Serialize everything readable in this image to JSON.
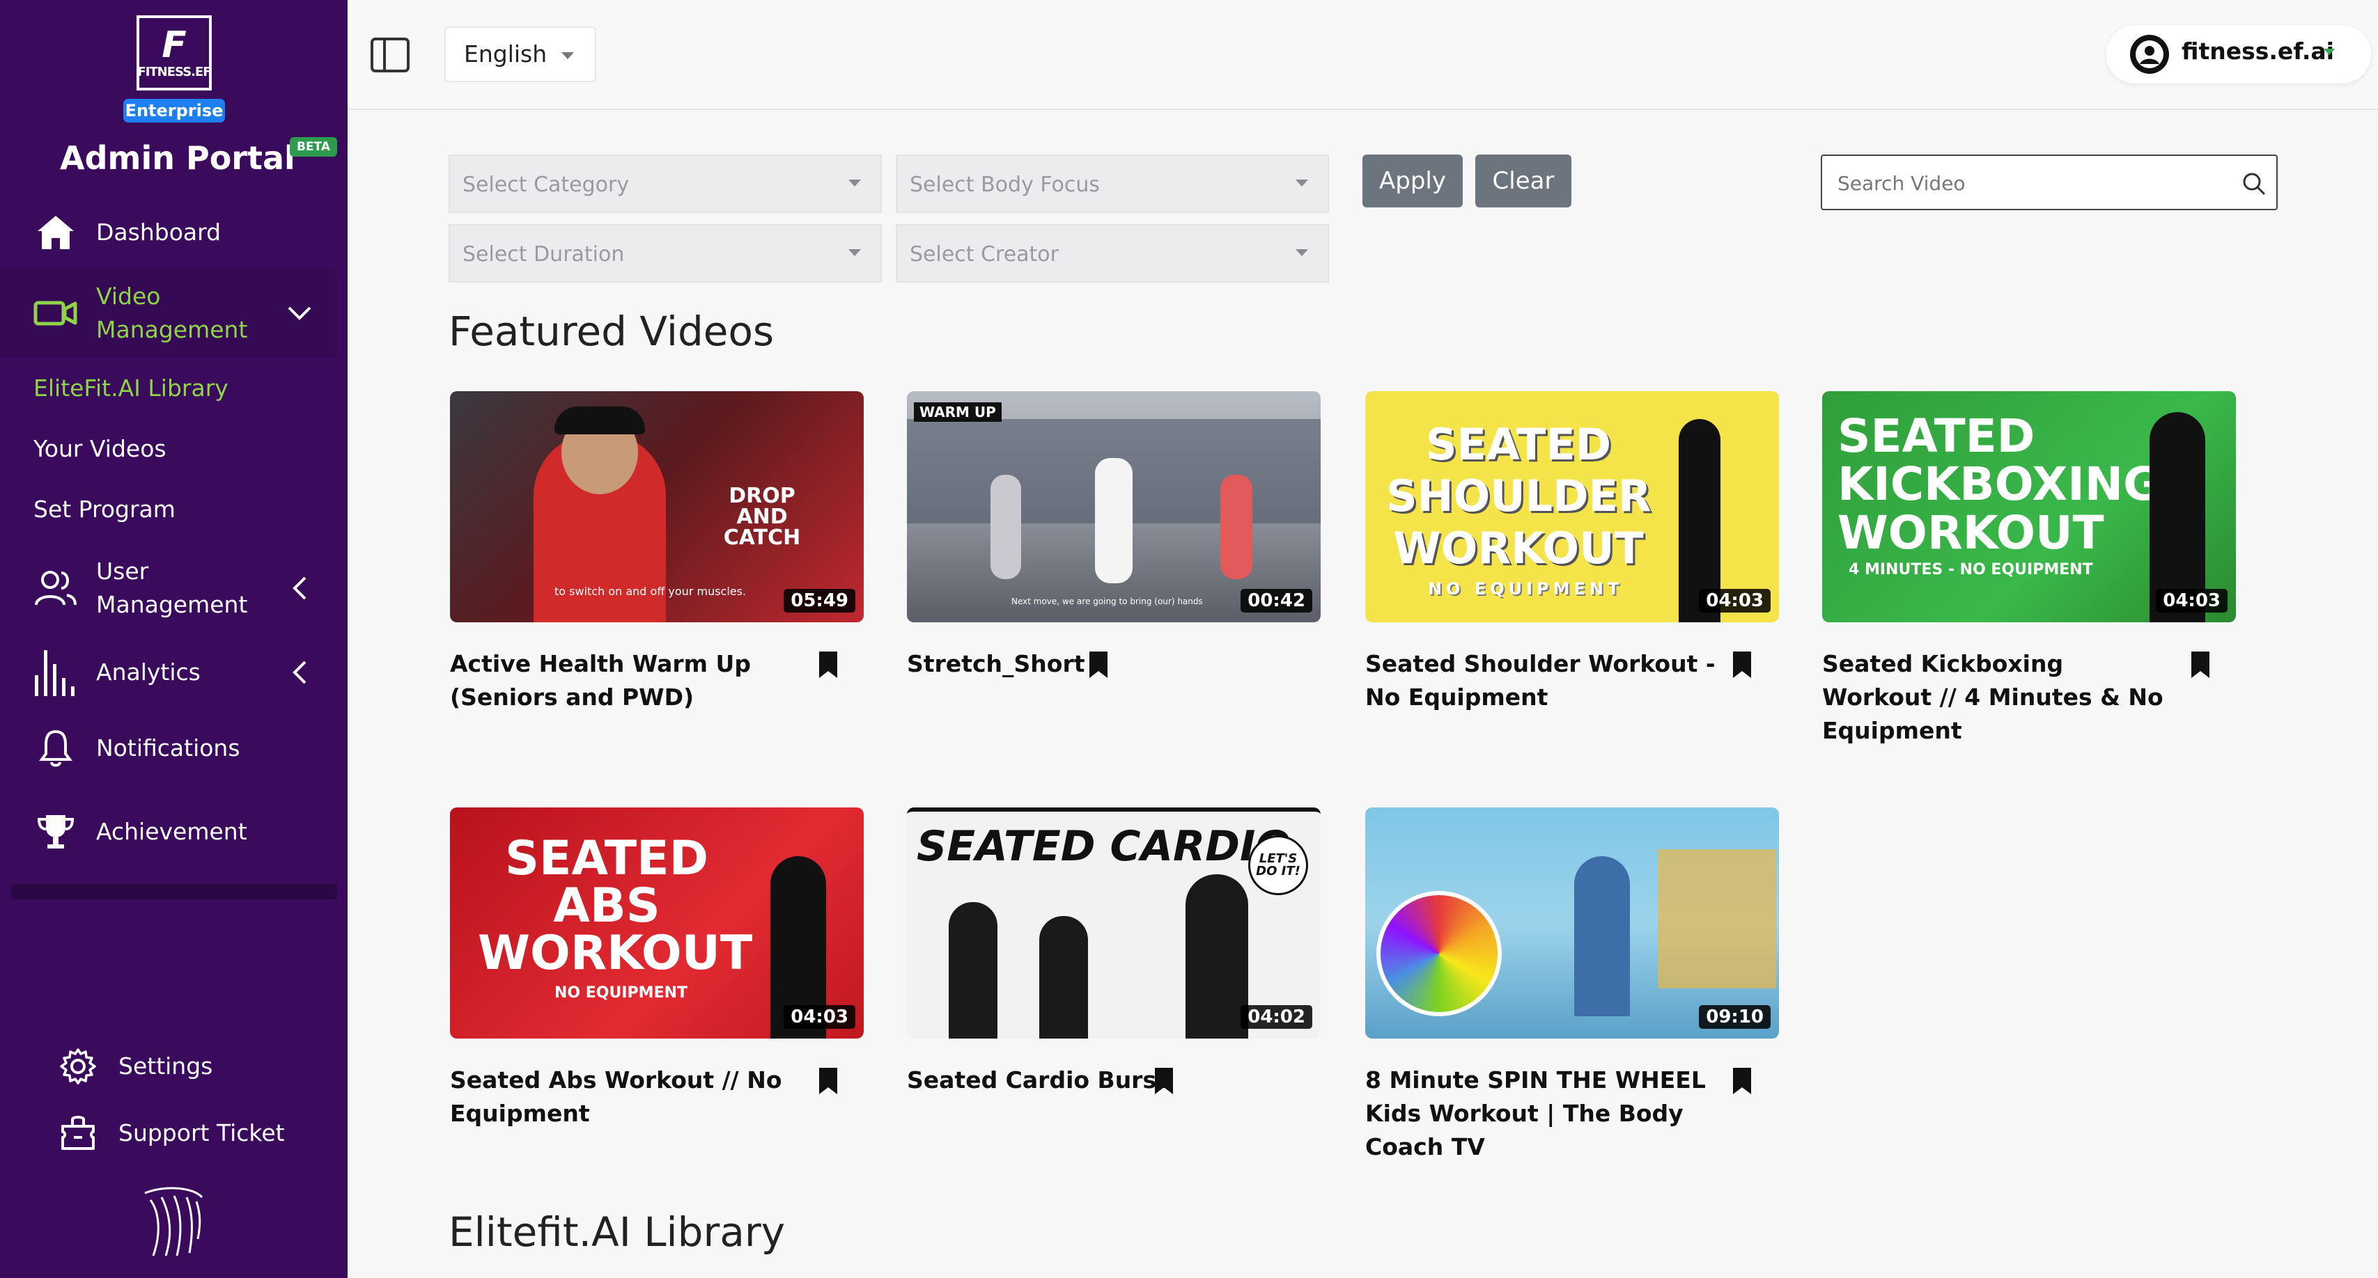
{
  "sidebar": {
    "logo_letter": "F",
    "logo_text": "FITNESS.EF",
    "badge": "Enterprise",
    "title": "Admin Portal",
    "beta": "BETA",
    "items": {
      "dashboard": "Dashboard",
      "video_management": "Video Management",
      "user_management": "User Management",
      "analytics": "Analytics",
      "notifications": "Notifications",
      "achievement": "Achievement"
    },
    "sub_items": [
      "EliteFit.AI Library",
      "Your Videos",
      "Set Program"
    ],
    "settings": "Settings",
    "support": "Support Ticket"
  },
  "topbar": {
    "language": "English",
    "account": "fitness.ef.ai"
  },
  "filters": {
    "category": "Select Category",
    "body_focus": "Select Body Focus",
    "duration": "Select Duration",
    "creator": "Select Creator",
    "apply": "Apply",
    "clear": "Clear",
    "search_placeholder": "Search Video"
  },
  "sections": {
    "featured": "Featured Videos",
    "library": "Elitefit.AI Library"
  },
  "videos": [
    {
      "title": "Active Health Warm Up (Seniors and PWD)",
      "duration": "05:49",
      "thumb_text": "DROP AND CATCH",
      "caption": "to switch on and off your muscles."
    },
    {
      "title": "Stretch_Short",
      "duration": "00:42",
      "thumb_text": "WARM UP",
      "caption": "Next move, we are going to bring (our) hands"
    },
    {
      "title": "Seated Shoulder Workout - No Equipment",
      "duration": "04:03",
      "thumb_text": "SEATED SHOULDER WORKOUT",
      "caption": "NO EQUIPMENT"
    },
    {
      "title": "Seated Kickboxing Workout // 4 Minutes & No Equipment",
      "duration": "04:03",
      "thumb_text": "SEATED KICKBOXING WORKOUT",
      "caption": "4 MINUTES - NO EQUIPMENT"
    },
    {
      "title": "Seated Abs Workout // No Equipment",
      "duration": "04:03",
      "thumb_text": "SEATED ABS WORKOUT",
      "caption": "NO EQUIPMENT"
    },
    {
      "title": "Seated Cardio Burst",
      "duration": "04:02",
      "thumb_text": "SEATED CARDIO",
      "caption": "LET'S DO IT!"
    },
    {
      "title": "8 Minute SPIN THE WHEEL Kids Workout | The Body Coach TV",
      "duration": "09:10",
      "thumb_text": "",
      "caption": ""
    }
  ],
  "colors": {
    "sidebar": "#3a0a5c",
    "accent_green": "#8ed449",
    "button_gray": "#6c757d",
    "enterprise_blue": "#1e7ff0"
  }
}
